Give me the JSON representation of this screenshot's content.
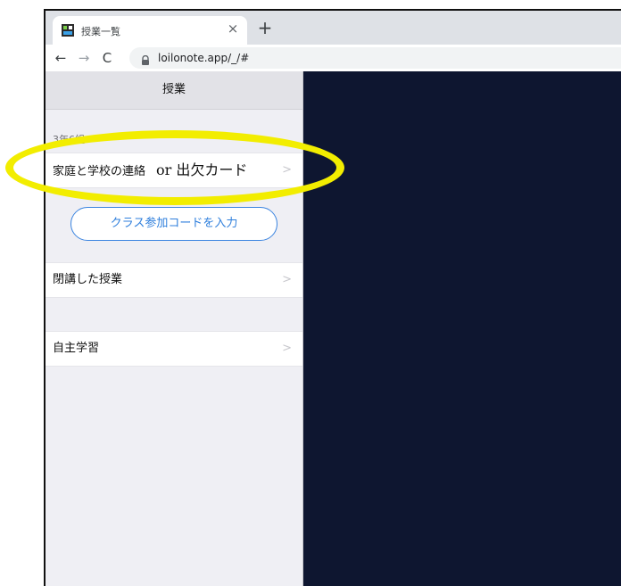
{
  "browser": {
    "tab_title": "授業一覧",
    "tab_close": "×",
    "new_tab": "+",
    "url": "loilonote.app/_/#",
    "back": "←",
    "forward": "→",
    "reload": "C"
  },
  "sidebar": {
    "title": "授業",
    "section_label": "3年6組",
    "class_item": {
      "label": "家庭と学校の連絡",
      "overlay_text": "or 出欠カード"
    },
    "join_button_label": "クラス参加コードを入力",
    "closed_item_label": "閉講した授業",
    "self_study_label": "自主学習",
    "chevron": ">"
  },
  "colors": {
    "accent_blue": "#2f7fdc",
    "highlight_yellow": "#f2ed00",
    "content_background": "#0e1630",
    "sidebar_background": "#efeff4"
  },
  "icons": [
    "app-favicon-icon",
    "close-icon",
    "plus-icon",
    "back-arrow-icon",
    "forward-arrow-icon",
    "reload-icon",
    "lock-icon",
    "chevron-right-icon"
  ]
}
